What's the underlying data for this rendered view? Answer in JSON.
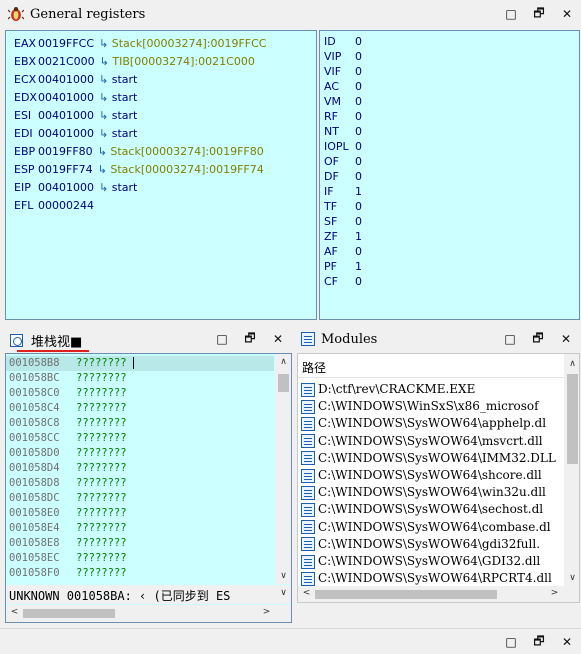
{
  "registers_panel": {
    "title": "General registers",
    "registers": [
      {
        "name": "EAX",
        "value": "0019FFCC",
        "arrow": "↳",
        "info": "Stack[00003274]:0019FFCC",
        "info_color": "olive"
      },
      {
        "name": "EBX",
        "value": "0021C000",
        "arrow": "↳",
        "info": "TIB[00003274]:0021C000",
        "info_color": "olive"
      },
      {
        "name": "ECX",
        "value": "00401000",
        "arrow": "↳",
        "info": "start",
        "info_color": "blue"
      },
      {
        "name": "EDX",
        "value": "00401000",
        "arrow": "↳",
        "info": "start",
        "info_color": "blue"
      },
      {
        "name": "ESI",
        "value": "00401000",
        "arrow": "↳",
        "info": "start",
        "info_color": "blue"
      },
      {
        "name": "EDI",
        "value": "00401000",
        "arrow": "↳",
        "info": "start",
        "info_color": "blue"
      },
      {
        "name": "EBP",
        "value": "0019FF80",
        "arrow": "↳",
        "info": "Stack[00003274]:0019FF80",
        "info_color": "olive"
      },
      {
        "name": "ESP",
        "value": "0019FF74",
        "arrow": "↳",
        "info": "Stack[00003274]:0019FF74",
        "info_color": "olive"
      },
      {
        "name": "EIP",
        "value": "00401000",
        "arrow": "↳",
        "info": "start",
        "info_color": "blue"
      },
      {
        "name": "EFL",
        "value": "00000244",
        "arrow": "",
        "info": "",
        "info_color": "blue"
      }
    ],
    "flags": [
      {
        "name": "ID",
        "value": "0"
      },
      {
        "name": "VIP",
        "value": "0"
      },
      {
        "name": "VIF",
        "value": "0"
      },
      {
        "name": "AC",
        "value": "0"
      },
      {
        "name": "VM",
        "value": "0"
      },
      {
        "name": "RF",
        "value": "0"
      },
      {
        "name": "NT",
        "value": "0"
      },
      {
        "name": "IOPL",
        "value": "0"
      },
      {
        "name": "OF",
        "value": "0"
      },
      {
        "name": "DF",
        "value": "0"
      },
      {
        "name": "IF",
        "value": "1"
      },
      {
        "name": "TF",
        "value": "0"
      },
      {
        "name": "SF",
        "value": "0"
      },
      {
        "name": "ZF",
        "value": "1"
      },
      {
        "name": "AF",
        "value": "0"
      },
      {
        "name": "PF",
        "value": "1"
      },
      {
        "name": "CF",
        "value": "0"
      }
    ]
  },
  "stack_panel": {
    "tab_label": "堆栈视■",
    "rows": [
      {
        "addr": "001058B8",
        "value": "???????? "
      },
      {
        "addr": "001058BC",
        "value": "????????"
      },
      {
        "addr": "001058C0",
        "value": "????????"
      },
      {
        "addr": "001058C4",
        "value": "????????"
      },
      {
        "addr": "001058C8",
        "value": "????????"
      },
      {
        "addr": "001058CC",
        "value": "????????"
      },
      {
        "addr": "001058D0",
        "value": "????????"
      },
      {
        "addr": "001058D4",
        "value": "????????"
      },
      {
        "addr": "001058D8",
        "value": "????????"
      },
      {
        "addr": "001058DC",
        "value": "????????"
      },
      {
        "addr": "001058E0",
        "value": "????????"
      },
      {
        "addr": "001058E4",
        "value": "????????"
      },
      {
        "addr": "001058E8",
        "value": "????????"
      },
      {
        "addr": "001058EC",
        "value": "????????"
      },
      {
        "addr": "001058F0",
        "value": "????????"
      }
    ],
    "status_text": "UNKNOWN 001058BA: ‹ (已同步到 ES"
  },
  "modules_panel": {
    "title": "Modules",
    "column_header": "路径",
    "modules": [
      "D:\\ctf\\rev\\CRACKME.EXE",
      "C:\\WINDOWS\\WinSxS\\x86_microsof",
      "C:\\WINDOWS\\SysWOW64\\apphelp.dl",
      "C:\\WINDOWS\\SysWOW64\\msvcrt.dll",
      "C:\\WINDOWS\\SysWOW64\\IMM32.DLL",
      "C:\\WINDOWS\\SysWOW64\\shcore.dll",
      "C:\\WINDOWS\\SysWOW64\\win32u.dll",
      "C:\\WINDOWS\\SysWOW64\\sechost.dl",
      "C:\\WINDOWS\\SysWOW64\\combase.dl",
      "C:\\WINDOWS\\SysWOW64\\gdi32full.",
      "C:\\WINDOWS\\SysWOW64\\GDI32.dll",
      "C:\\WINDOWS\\SysWOW64\\RPCRT4.dll"
    ]
  },
  "window_buttons": {
    "minimize": "□",
    "float": "🗗",
    "close": "✕"
  },
  "scroll_glyphs": {
    "up": "∧",
    "down": "∨",
    "left": "<",
    "right": ">"
  },
  "colors": {
    "pane_bg": "#ccffff",
    "register_blue": "#000080",
    "info_olive": "#808000",
    "stack_green": "#008000",
    "tab_underline": "#e0201c"
  }
}
